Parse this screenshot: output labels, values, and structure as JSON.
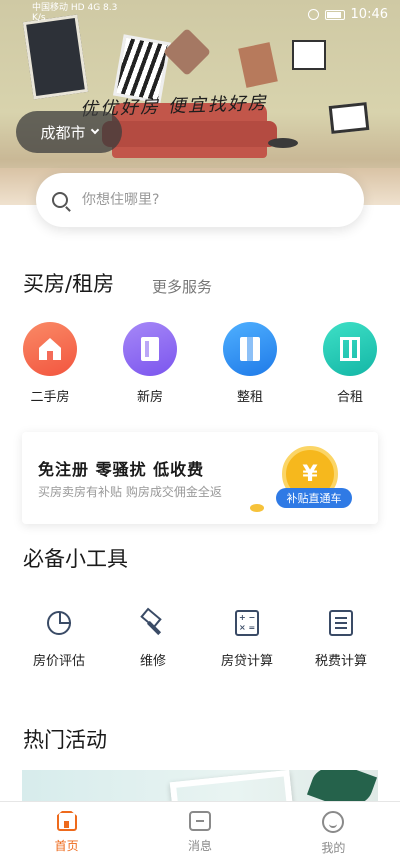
{
  "status_bar": {
    "carrier": "中国移动",
    "hd_badge": "HD",
    "network": "4G",
    "speed": "8.3\nK/s",
    "time": "10:46"
  },
  "hero": {
    "slogan": "优优好房 便宜找好房",
    "city": "成都市"
  },
  "search": {
    "placeholder": "你想住哪里?"
  },
  "services": {
    "title": "买房/租房",
    "more": "更多服务",
    "items": [
      {
        "label": "二手房",
        "icon": "house-icon",
        "color": "#f46b58"
      },
      {
        "label": "新房",
        "icon": "building-icon",
        "color": "#8d6df2"
      },
      {
        "label": "整租",
        "icon": "book-icon",
        "color": "#2d8cf0"
      },
      {
        "label": "合租",
        "icon": "door-icon",
        "color": "#23c7b7"
      }
    ]
  },
  "promo": {
    "title": "免注册 零骚扰 低收费",
    "subtitle": "买房卖房有补贴 购房成交佣金全返",
    "coin_symbol": "¥",
    "tag": "补贴直通车"
  },
  "tools": {
    "title": "必备小工具",
    "items": [
      {
        "label": "房价评估",
        "icon": "pie-chart-icon"
      },
      {
        "label": "维修",
        "icon": "hammer-icon"
      },
      {
        "label": "房贷计算",
        "icon": "calculator-icon"
      },
      {
        "label": "税费计算",
        "icon": "list-icon"
      }
    ]
  },
  "activities": {
    "title": "热门活动"
  },
  "tabbar": {
    "items": [
      {
        "label": "首页",
        "icon": "home-icon",
        "active": true
      },
      {
        "label": "消息",
        "icon": "message-icon",
        "active": false
      },
      {
        "label": "我的",
        "icon": "user-icon",
        "active": false
      }
    ],
    "active_color": "#ee6a1c"
  }
}
